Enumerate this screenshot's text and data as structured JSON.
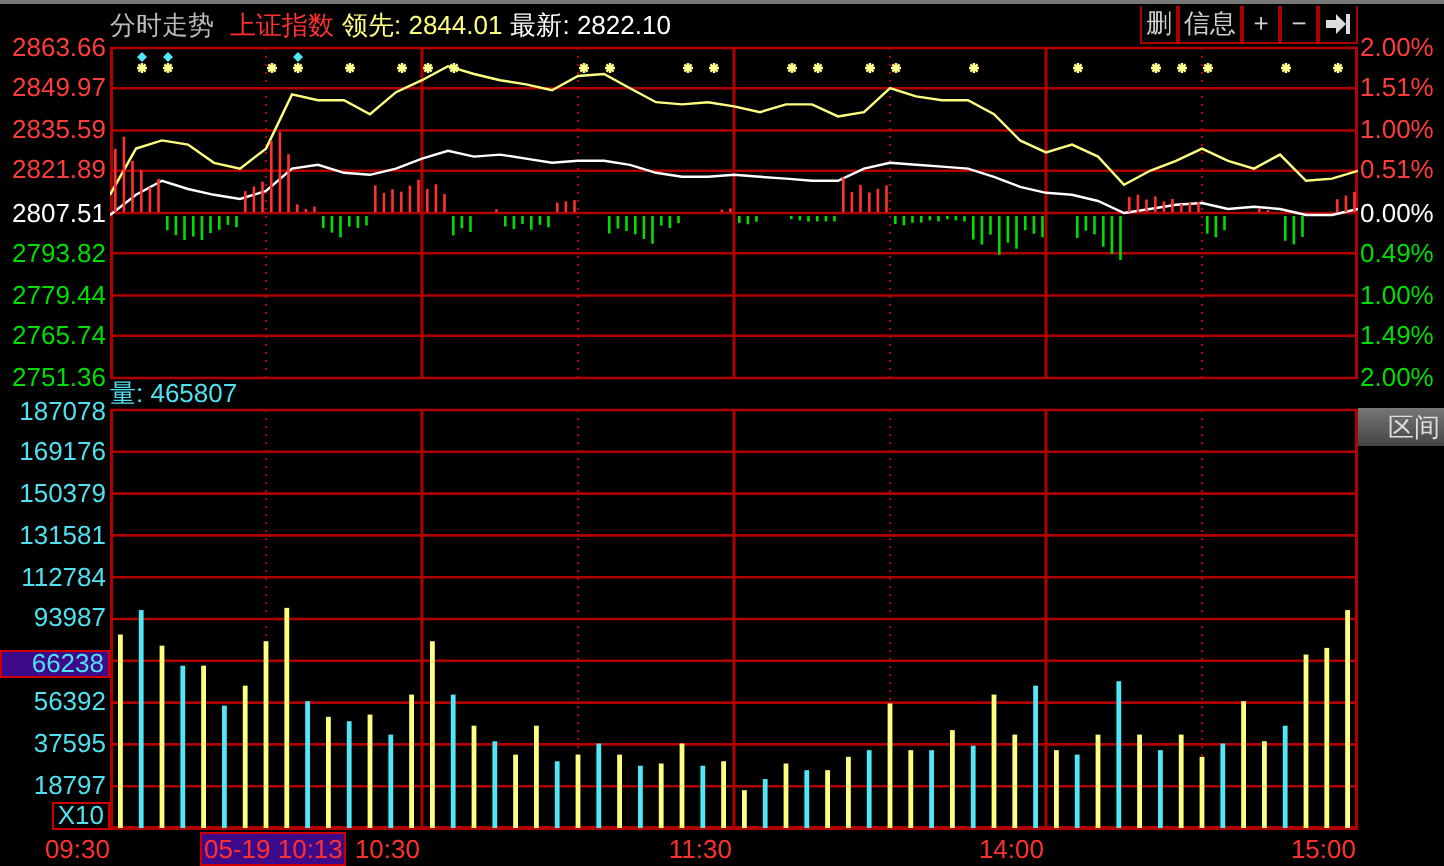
{
  "header": {
    "view_title": "分时走势",
    "index_name": "上证指数",
    "leading_label": "领先:",
    "leading_value": "2844.01",
    "latest_label": "最新:",
    "latest_value": "2822.10"
  },
  "toolbar": [
    {
      "kind": "text",
      "label": "删"
    },
    {
      "kind": "text",
      "label": "信息"
    },
    {
      "kind": "text",
      "label": "+"
    },
    {
      "kind": "text",
      "label": "−"
    },
    {
      "kind": "icon"
    }
  ],
  "price_panel": {
    "right_axis": [
      "2.00%",
      "1.51%",
      "1.00%",
      "0.51%",
      "0.00%",
      "0.49%",
      "1.00%",
      "1.49%",
      "2.00%"
    ],
    "chart_data": {
      "type": "line",
      "grid": true,
      "ylim": [
        2751.36,
        2863.66
      ],
      "yticks": [
        {
          "value": 2863.66,
          "label": "2863.66"
        },
        {
          "value": 2849.97,
          "label": "2849.97"
        },
        {
          "value": 2835.59,
          "label": "2835.59"
        },
        {
          "value": 2821.89,
          "label": "2821.89"
        },
        {
          "value": 2807.51,
          "label": "2807.51"
        },
        {
          "value": 2793.82,
          "label": "2793.82"
        },
        {
          "value": 2779.44,
          "label": "2779.44"
        },
        {
          "value": 2765.74,
          "label": "2765.74"
        },
        {
          "value": 2751.36,
          "label": "2751.36"
        }
      ],
      "categories": [
        null,
        null,
        null,
        null,
        null,
        null,
        null,
        null,
        null,
        null,
        null,
        null,
        null,
        null,
        null,
        null,
        null,
        null,
        null,
        null,
        null,
        null,
        null,
        null,
        null,
        null,
        null,
        null,
        null,
        null,
        null,
        null,
        null,
        null,
        null,
        null,
        null,
        null,
        null,
        null,
        null,
        null,
        null,
        null,
        null,
        null,
        null,
        null,
        null
      ],
      "series": [
        {
          "color": "#ffff80",
          "values": [
            2813.7,
            2829.4,
            2832.2,
            2830.8,
            2824.6,
            2822.6,
            2829.4,
            2847.9,
            2845.9,
            2845.9,
            2841.1,
            2848.6,
            2852.7,
            2857.5,
            2854.8,
            2852.7,
            2851.3,
            2849.3,
            2854.1,
            2854.8,
            2850.0,
            2845.2,
            2844.5,
            2845.2,
            2843.8,
            2841.8,
            2844.5,
            2844.5,
            2840.4,
            2841.8,
            2850.0,
            2847.2,
            2845.9,
            2845.9,
            2841.1,
            2832.2,
            2828.1,
            2830.8,
            2826.7,
            2817.1,
            2821.9,
            2825.3,
            2829.4,
            2825.3,
            2822.6,
            2827.4,
            2818.5,
            2819.2,
            2821.9
          ]
        },
        {
          "color": "#ffffff",
          "values": [
            2806.8,
            2813.7,
            2818.5,
            2815.7,
            2813.7,
            2812.3,
            2815.0,
            2822.6,
            2823.9,
            2821.2,
            2820.5,
            2822.6,
            2826.0,
            2828.7,
            2826.7,
            2827.4,
            2826.0,
            2824.6,
            2825.3,
            2825.3,
            2823.9,
            2821.2,
            2819.8,
            2819.8,
            2820.5,
            2819.8,
            2819.2,
            2818.5,
            2818.5,
            2822.6,
            2824.6,
            2823.9,
            2823.3,
            2822.6,
            2819.8,
            2816.4,
            2814.4,
            2813.7,
            2811.6,
            2807.5,
            2808.9,
            2810.3,
            2810.9,
            2808.9,
            2809.6,
            2808.9,
            2806.8,
            2806.8,
            2808.9
          ]
        }
      ]
    }
  },
  "volume_panel": {
    "label": "量:",
    "total": "465807",
    "range_button": "区间",
    "cursor_value": "66238",
    "scale": "X10",
    "chart_data": {
      "type": "bar",
      "grid": true,
      "ylim": [
        0,
        187973
      ],
      "yticks": [
        {
          "value": 187078,
          "label": "187078"
        },
        {
          "value": 169176,
          "label": "169176"
        },
        {
          "value": 150379,
          "label": "150379"
        },
        {
          "value": 131581,
          "label": "131581"
        },
        {
          "value": 112784,
          "label": "112784"
        },
        {
          "value": 93987,
          "label": "93987"
        },
        {
          "value": 56392,
          "label": "56392"
        },
        {
          "value": 37595,
          "label": "37595"
        },
        {
          "value": 18797,
          "label": "18797"
        }
      ],
      "categories": [
        null,
        null,
        null,
        null,
        null,
        null,
        null,
        null,
        null,
        null,
        null,
        null,
        null,
        null,
        null,
        null,
        null,
        null,
        null,
        null,
        null,
        null,
        null,
        null,
        null,
        null,
        null,
        null,
        null,
        null,
        null,
        null,
        null,
        null,
        null,
        null,
        null,
        null,
        null,
        null,
        null,
        null,
        null,
        null,
        null,
        null,
        null,
        null,
        null,
        null,
        null,
        null,
        null,
        null,
        null,
        null,
        null,
        null,
        null,
        null
      ],
      "series": [
        {
          "color": "#ffff80",
          "values": [
            87000,
            0,
            82000,
            0,
            73000,
            0,
            64000,
            84000,
            99000,
            0,
            50000,
            0,
            51000,
            0,
            60000,
            84000,
            0,
            46000,
            0,
            33000,
            46000,
            0,
            33000,
            0,
            33000,
            0,
            29000,
            38000,
            0,
            30000,
            17000,
            0,
            29000,
            0,
            26000,
            32000,
            0,
            56000,
            35000,
            0,
            44000,
            0,
            60000,
            42000,
            0,
            35000,
            0,
            42000,
            0,
            42000,
            0,
            42000,
            32000,
            0,
            57000,
            39000,
            0,
            78000,
            81000,
            98000
          ]
        },
        {
          "color": "#50e8f8",
          "values": [
            0,
            98000,
            0,
            73000,
            0,
            55000,
            0,
            0,
            0,
            57000,
            0,
            48000,
            0,
            42000,
            0,
            0,
            60000,
            0,
            39000,
            0,
            0,
            30000,
            0,
            38000,
            0,
            28000,
            0,
            0,
            28000,
            0,
            0,
            22000,
            0,
            26000,
            0,
            0,
            35000,
            0,
            0,
            35000,
            0,
            37000,
            0,
            0,
            64000,
            0,
            33000,
            0,
            66000,
            0,
            35000,
            0,
            0,
            38000,
            0,
            0,
            46000,
            0,
            0,
            0
          ]
        }
      ]
    }
  },
  "time_axis": {
    "labels": [
      "09:30",
      "10:30",
      "11:30",
      "14:00",
      "15:00"
    ],
    "cursor_time": "05-19 10:13"
  }
}
